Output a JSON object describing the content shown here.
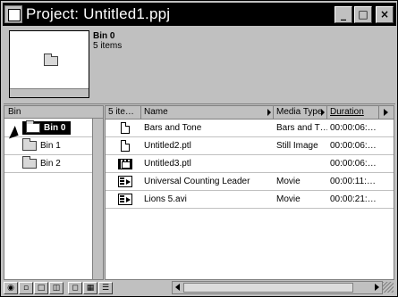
{
  "window": {
    "title": "Project: Untitled1.ppj",
    "controls": {
      "minimize": "_",
      "maximize": "□",
      "close": "×"
    }
  },
  "preview": {
    "bin_name": "Bin 0",
    "item_count": "5 items"
  },
  "bins_pane": {
    "header": "Bin",
    "items": [
      {
        "label": "Bin 0",
        "selected": true
      },
      {
        "label": "Bin 1",
        "selected": false
      },
      {
        "label": "Bin 2",
        "selected": false
      }
    ]
  },
  "items_pane": {
    "columns": [
      "5 ite…",
      "Name",
      "Media Type",
      "Duration"
    ],
    "rows": [
      {
        "icon": "document-icon",
        "name": "Bars and Tone",
        "type": "Bars and T…",
        "duration": "00:00:06:…"
      },
      {
        "icon": "document-icon",
        "name": "Untitled2.ptl",
        "type": "Still Image",
        "duration": "00:00:06:…"
      },
      {
        "icon": "filmstrip-icon",
        "name": "Untitled3.ptl",
        "type": "",
        "duration": "00:00:06:…"
      },
      {
        "icon": "movie-icon",
        "name": "Universal Counting Leader",
        "type": "Movie",
        "duration": "00:00:11:…"
      },
      {
        "icon": "movie-icon",
        "name": "Lions 5.avi",
        "type": "Movie",
        "duration": "00:00:21:…"
      }
    ]
  },
  "toolbar": {
    "buttons": [
      "find-icon",
      "new-bin-icon",
      "new-item-icon",
      "delete-icon",
      "icon-view-icon",
      "thumbnail-view-icon",
      "list-view-icon"
    ]
  }
}
